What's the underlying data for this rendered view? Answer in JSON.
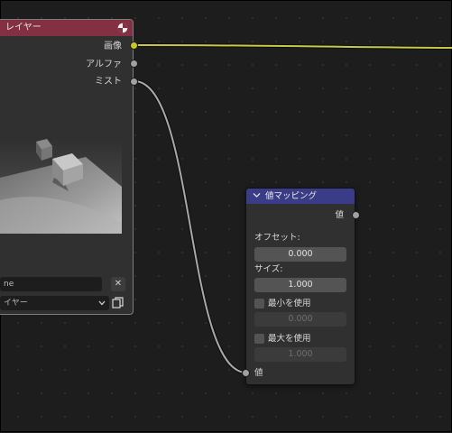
{
  "render_layers_node": {
    "title": "レイヤー",
    "outputs": [
      "画像",
      "アルファ",
      "ミスト"
    ],
    "scene_field_text": "ne",
    "layer_select_text": "イヤー",
    "clear_button": "✕",
    "copy_icon": "copy-icon"
  },
  "map_value_node": {
    "title": "値マッピング",
    "output_label": "値",
    "offset_label": "オフセット:",
    "offset_value": "0.000",
    "size_label": "サイズ:",
    "size_value": "1.000",
    "use_min_label": "最小を使用",
    "min_value": "0.000",
    "use_max_label": "最大を使用",
    "max_value": "1.000",
    "input_label": "値"
  },
  "colors": {
    "render_header": "#833042",
    "map_header": "#3a3c87",
    "image_socket": "#c7c729",
    "value_socket": "#a1a1a1"
  }
}
